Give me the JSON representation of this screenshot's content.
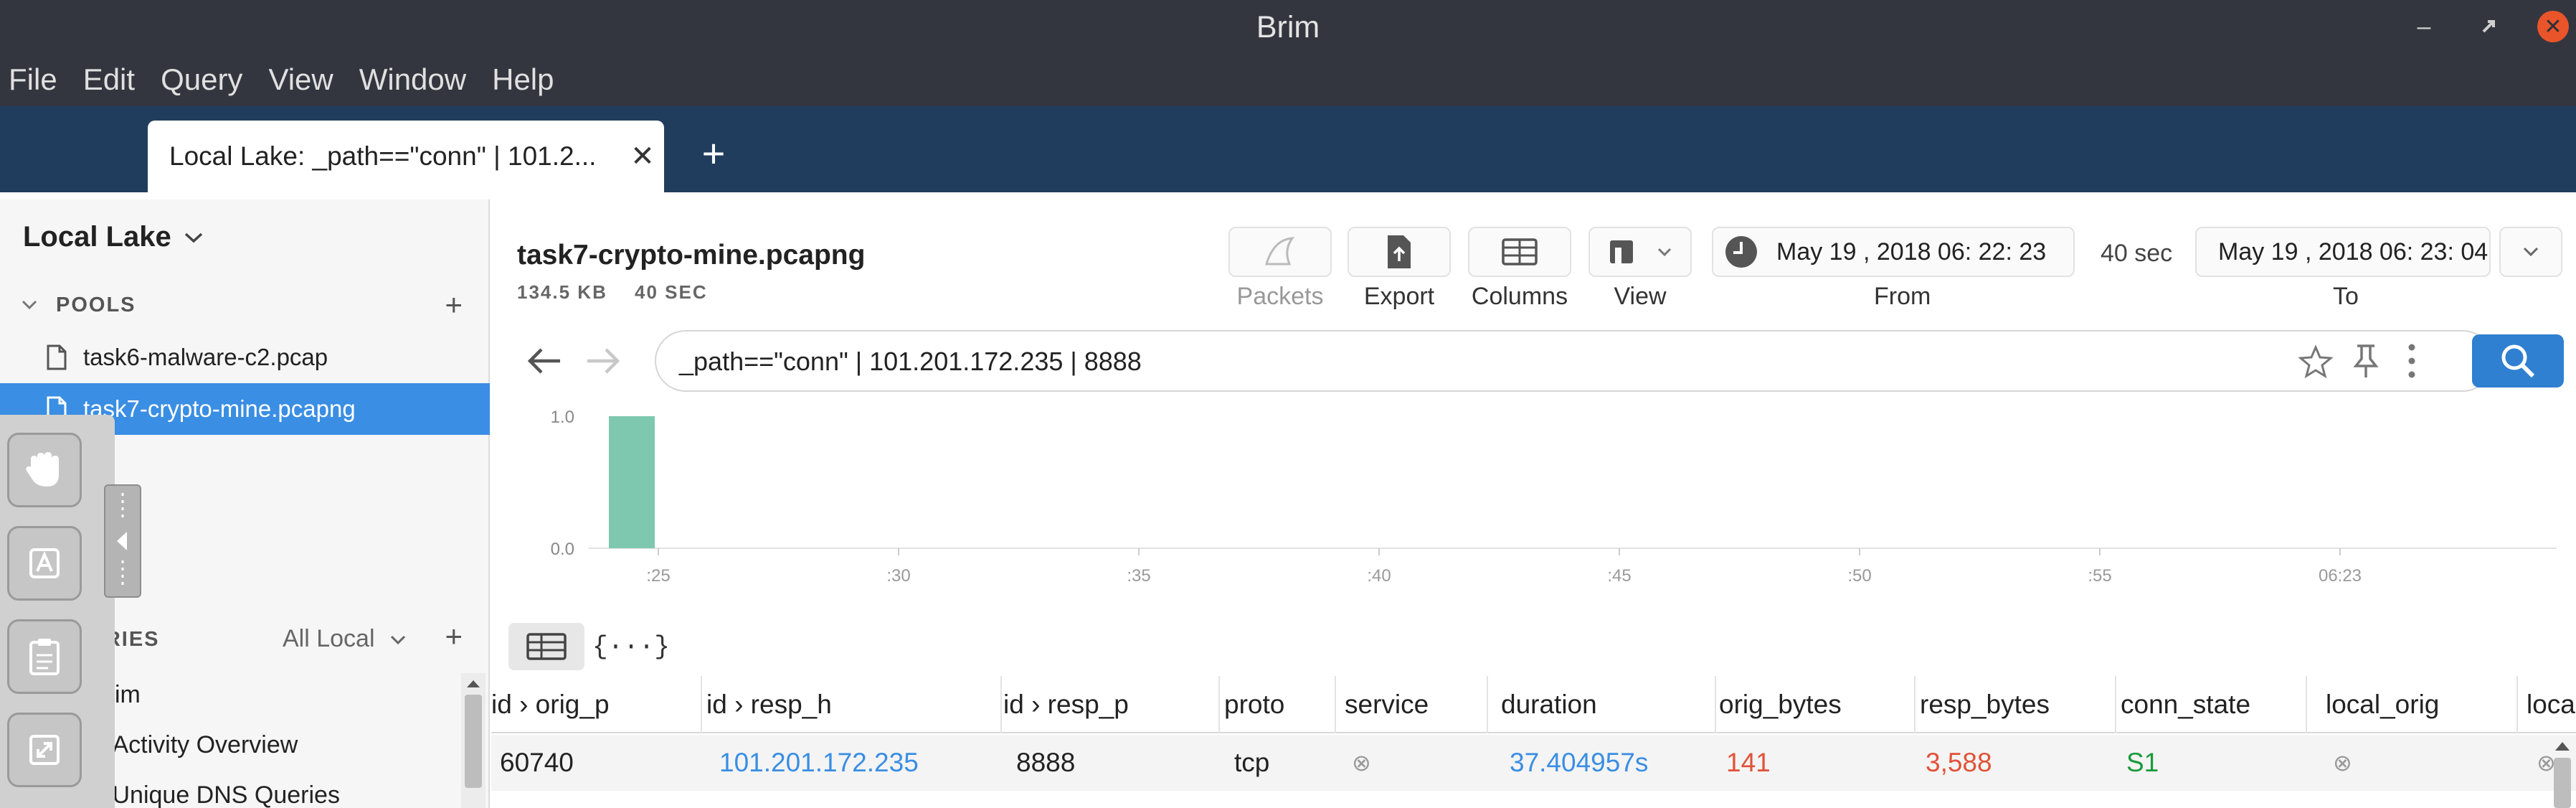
{
  "window": {
    "title": "Brim"
  },
  "menu": [
    "File",
    "Edit",
    "Query",
    "View",
    "Window",
    "Help"
  ],
  "tab": {
    "label": "Local Lake: _path==\"conn\" | 101.2...",
    "close": "✕",
    "add": "+"
  },
  "sidebar": {
    "lake": "Local Lake",
    "pools_label": "POOLS",
    "pools": [
      "task6-malware-c2.pcap",
      "task7-crypto-mine.pcapng"
    ],
    "queries_label": "QUERIES",
    "queries_scope": "All Local",
    "queries": [
      "Brim",
      "Activity Overview",
      "Unique DNS Queries"
    ]
  },
  "pool": {
    "name": "task7-crypto-mine.pcapng",
    "size": "134.5 KB",
    "duration": "40 SEC"
  },
  "toolbar": {
    "packets": "Packets",
    "export": "Export",
    "columns": "Columns",
    "view": "View",
    "from_label": "From",
    "to_label": "To",
    "from_value": "May  19 , 2018  06: 22: 23",
    "span": "40 sec",
    "to_value": "May  19 , 2018  06: 23: 04"
  },
  "search": {
    "query": "_path==\"conn\" | 101.201.172.235 | 8888"
  },
  "chart_data": {
    "type": "bar",
    "categories": [
      ":23"
    ],
    "values": [
      1.0
    ],
    "y_ticks": [
      "1.0",
      "0.0"
    ],
    "x_ticks": [
      ":25",
      ":30",
      ":35",
      ":40",
      ":45",
      ":50",
      ":55",
      "06:23"
    ],
    "ylim": [
      0,
      1
    ],
    "bar_color": "#7ec8b0",
    "grid": false
  },
  "viewmode": {
    "json": "{···}"
  },
  "table": {
    "columns": [
      "id › orig_p",
      "id › resp_h",
      "id › resp_p",
      "proto",
      "service",
      "duration",
      "orig_bytes",
      "resp_bytes",
      "conn_state",
      "local_orig",
      "loca"
    ],
    "rows": [
      [
        "60740",
        "101.201.172.235",
        "8888",
        "tcp",
        "⊗",
        "37.404957s",
        "141",
        "3,588",
        "S1",
        "⊗",
        "⊗"
      ]
    ]
  },
  "colors": {
    "accent": "#3a8ee3",
    "tabbar": "#213d5e",
    "titlebar": "#34363f"
  }
}
